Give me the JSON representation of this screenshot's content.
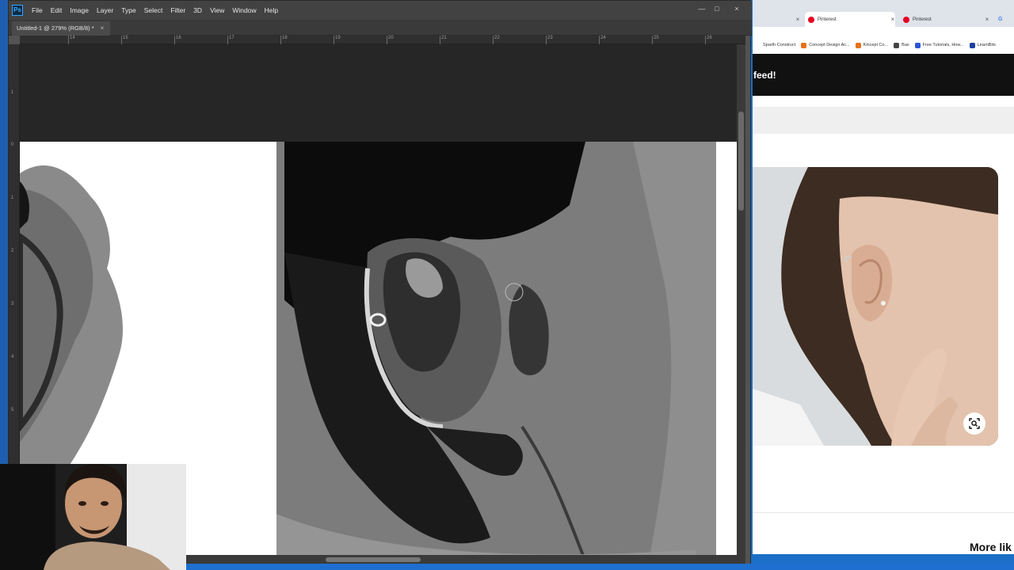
{
  "photoshop": {
    "menu": [
      "File",
      "Edit",
      "Image",
      "Layer",
      "Type",
      "Select",
      "Filter",
      "3D",
      "View",
      "Window",
      "Help"
    ],
    "logo": "Ps",
    "tab_title": "Untitled-1 @ 279% (RGB/8) *",
    "tab_close": "×",
    "window_controls": [
      "—",
      "□",
      "×"
    ],
    "ruler_h": [
      "14",
      "15",
      "16",
      "17",
      "18",
      "19",
      "20",
      "21",
      "22",
      "23",
      "24",
      "25",
      "26"
    ],
    "ruler_v": [
      "1",
      "0",
      "1",
      "2",
      "3",
      "4",
      "5"
    ]
  },
  "browser": {
    "tabs": [
      {
        "label": "",
        "close": "×"
      },
      {
        "label": "Pinterest",
        "close": "×"
      },
      {
        "label": "Pinterest",
        "close": "×"
      },
      {
        "label": "G",
        "close": ""
      }
    ],
    "bookmarks": [
      "Sparth Construct",
      "Concept Design Ac...",
      "Kincept Co...",
      "Bas",
      "Free Tutorials, How...",
      "LearnBits"
    ],
    "bookmark_colors": [
      "#ffffff",
      "#e8701a",
      "#e8701a",
      "#444444",
      "#2a55d8",
      "#1a3fa0"
    ],
    "banner_text": "feed!",
    "more_like": "More lik",
    "lens_icon": "visual-search-icon"
  },
  "colors": {
    "ps_menubar": "#424242",
    "ps_canvas": "#262626",
    "desktop": "#1b6fc6",
    "pinterest_red": "#e60023"
  }
}
